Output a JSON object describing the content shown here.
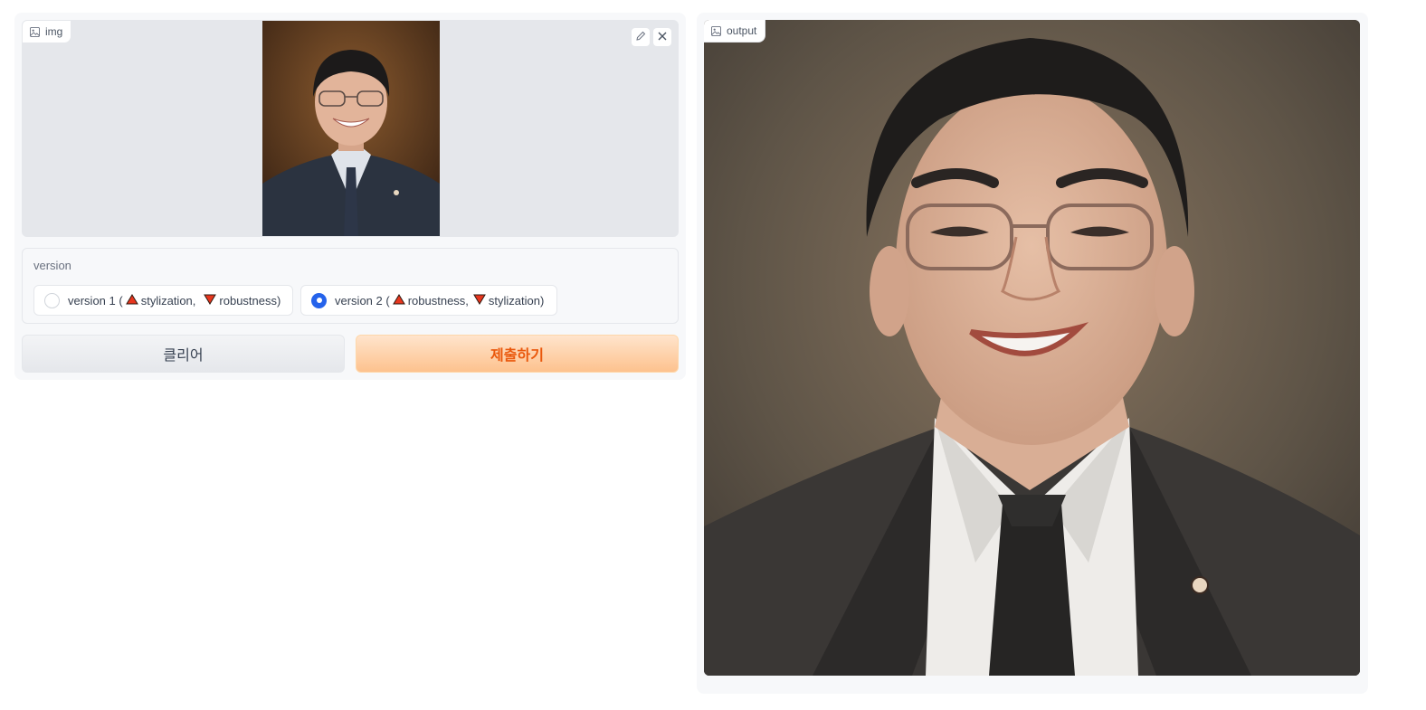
{
  "input_image": {
    "label": "img",
    "label_icon": "image-icon",
    "edit_icon": "pencil-icon",
    "clear_icon": "close-icon",
    "photo_alt": "portrait photo of a smiling man in a dark suit"
  },
  "version": {
    "label": "version",
    "options": [
      {
        "prefix": "version 1 (",
        "up": "stylization,",
        "down": "robustness)",
        "selected": false
      },
      {
        "prefix": "version 2 (",
        "up": "robustness,",
        "down": "stylization)",
        "selected": true
      }
    ],
    "up_icon": "red-triangle-up-icon",
    "down_icon": "red-triangle-down-icon"
  },
  "buttons": {
    "clear_label": "클리어",
    "submit_label": "제출하기"
  },
  "output": {
    "label": "output",
    "label_icon": "image-icon",
    "photo_alt": "stylized painted portrait of the man"
  },
  "colors": {
    "accent": "#2563eb",
    "submit_text": "#ea580c",
    "submit_bg": "#fdc28e",
    "panel_bg": "#f7f8fa"
  }
}
